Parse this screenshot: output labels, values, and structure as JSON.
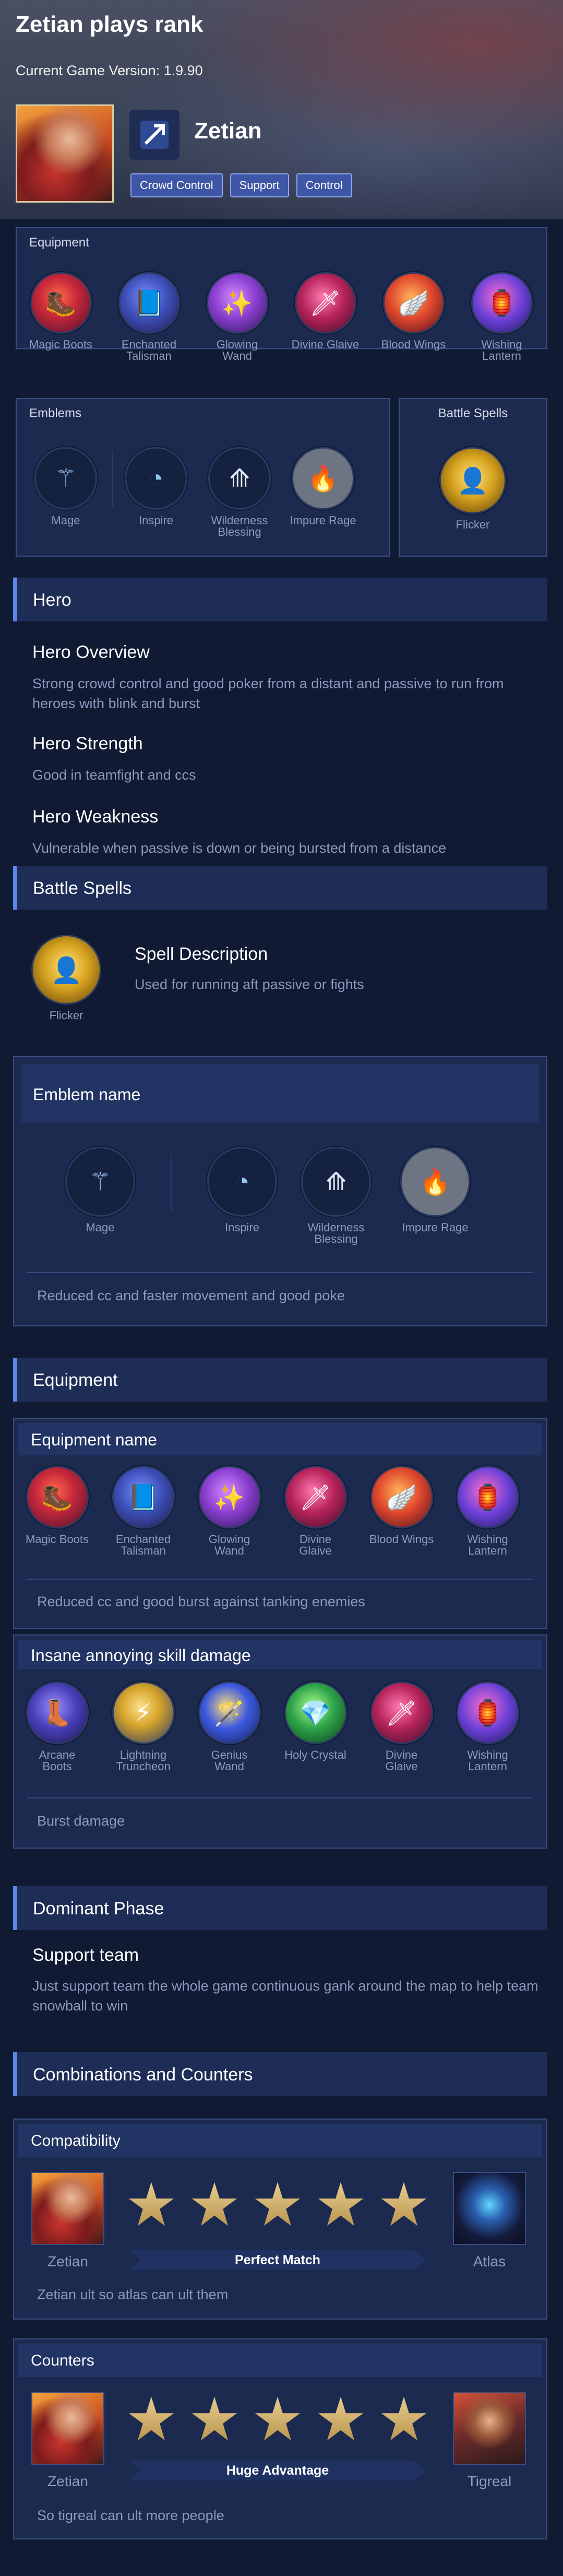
{
  "header": {
    "title": "Zetian plays rank",
    "version": "Current Game Version: 1.9.90",
    "hero_name": "Zetian",
    "roles": [
      "Crowd Control",
      "Support",
      "Control"
    ]
  },
  "equipment_panel": {
    "title": "Equipment",
    "items": [
      {
        "label": "Magic Boots",
        "icon": "magic-boots-icon",
        "color": "#c8283a"
      },
      {
        "label": "Enchanted Talisman",
        "icon": "enchanted-talisman-icon",
        "color": "#3c4fb8"
      },
      {
        "label": "Glowing Wand",
        "icon": "glowing-wand-icon",
        "color": "#8a3fd0"
      },
      {
        "label": "Divine Glaive",
        "icon": "divine-glaive-icon",
        "color": "#b5235a"
      },
      {
        "label": "Blood Wings",
        "icon": "blood-wings-icon",
        "color": "#e0472c"
      },
      {
        "label": "Wishing Lantern",
        "icon": "wishing-lantern-icon",
        "color": "#6a3fd6"
      }
    ]
  },
  "emblems_panel": {
    "title": "Emblems",
    "items": [
      {
        "label": "Mage",
        "icon": "mage-wand-icon"
      },
      {
        "label": "Inspire",
        "icon": "inspire-icon"
      },
      {
        "label": "Wilderness Blessing",
        "icon": "wilderness-blessing-icon"
      },
      {
        "label": "Impure Rage",
        "icon": "impure-rage-icon"
      }
    ]
  },
  "battle_spells_panel": {
    "title": "Battle Spells",
    "spell": "Flicker"
  },
  "hero_section": {
    "title": "Hero",
    "overview_title": "Hero Overview",
    "overview_text": "Strong crowd control and good poker from a distant and passive to run from heroes with blink and burst",
    "strength_title": "Hero Strength",
    "strength_text": "Good in teamfight and ccs",
    "weakness_title": "Hero Weakness",
    "weakness_text": "Vulnerable when passive is down or being bursted from a distance"
  },
  "battle_spells_section": {
    "title": "Battle Spells",
    "spell": "Flicker",
    "desc_title": "Spell Description",
    "desc_text": "Used for running aft passive or fights"
  },
  "emblem_section": {
    "title": "Emblem name",
    "items": [
      "Mage",
      "Inspire",
      "Wilderness Blessing",
      "Impure Rage"
    ],
    "note": "Reduced cc and faster movement and good poke"
  },
  "equipment_section": {
    "title": "Equipment",
    "build1": {
      "title": "Equipment name",
      "items": [
        "Magic Boots",
        "Enchanted Talisman",
        "Glowing Wand",
        "Divine Glaive",
        "Blood Wings",
        "Wishing Lantern"
      ],
      "note": "Reduced cc and good burst against tanking enemies"
    },
    "build2": {
      "title": "Insane annoying skill damage",
      "items": [
        "Arcane Boots",
        "Lightning Truncheon",
        "Genius Wand",
        "Holy Crystal",
        "Divine Glaive",
        "Wishing Lantern"
      ],
      "colors": [
        "#4a3fb8",
        "#d6a42a",
        "#3d5ae0",
        "#2ea34a",
        "#b5235a",
        "#6a3fd6"
      ],
      "note": "Burst damage"
    }
  },
  "dominant_phase": {
    "title": "Dominant Phase",
    "sub_title": "Support team",
    "text": "Just support team the whole game continuous gank around the map to help team snowball to win"
  },
  "combos": {
    "title": "Combinations and Counters",
    "compatibility": {
      "title": "Compatibility",
      "left_hero": "Zetian",
      "right_hero": "Atlas",
      "rating": 5,
      "rating_label": "Perfect Match",
      "note": "Zetian ult so atlas can ult them"
    },
    "counters": {
      "title": "Counters",
      "left_hero": "Zetian",
      "right_hero": "Tigreal",
      "rating": 5,
      "rating_label": "Huge Advantage",
      "note": "So tigreal can ult more people"
    }
  }
}
